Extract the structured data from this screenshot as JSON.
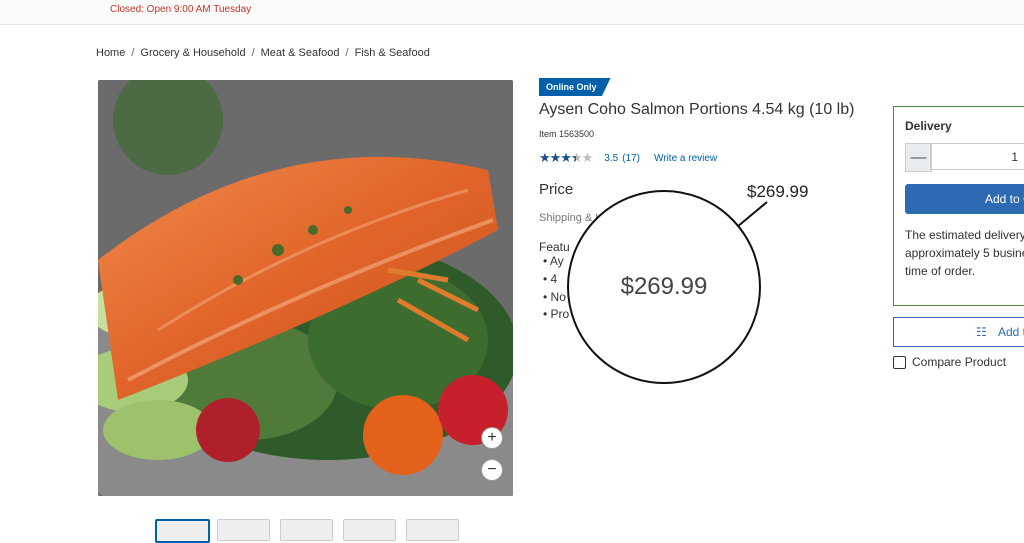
{
  "header": {
    "store_hours": "Closed: Open 9:00 AM Tuesday"
  },
  "breadcrumb": [
    "Home",
    "Grocery & Household",
    "Meat & Seafood",
    "Fish & Seafood"
  ],
  "product": {
    "badge": "Online Only",
    "title": "Aysen Coho Salmon Portions 4.54 kg (10 lb)",
    "item_number": "Item  1563500",
    "rating": {
      "value": "3.5",
      "value_number": 3.5,
      "count": "(17)",
      "write_review": "Write a review"
    },
    "price_label": "Price",
    "price_callout": "$269.99",
    "magnified_price": "$269.99",
    "shipping_text": "Shipping & H",
    "features_label": "Featu",
    "features": [
      "Ay",
      "4",
      "No",
      "Pro"
    ]
  },
  "gallery": {
    "zoom_in": "+",
    "zoom_out": "−",
    "thumbnail_count": 5,
    "active_thumbnail": 1
  },
  "delivery": {
    "title": "Delivery",
    "quantity": "1",
    "add_to_cart": "Add to C",
    "estimate_lines": [
      "The estimated delivery",
      "approximately 5 busine",
      "time of order."
    ]
  },
  "list_button": "Add t",
  "compare": "Compare Product",
  "colors": {
    "accent": "#0060a9",
    "button": "#2d6ab1",
    "box_border": "#4a8b3c",
    "alert_text": "#c0392b"
  }
}
